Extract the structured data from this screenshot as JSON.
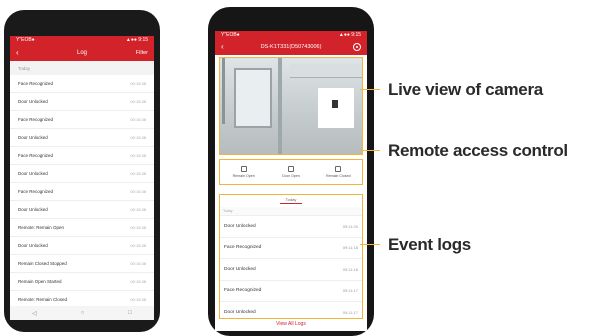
{
  "colors": {
    "brand_red": "#d2232a",
    "highlight": "#f2b53a"
  },
  "phone_log": {
    "status": {
      "left": "Y″EOB●",
      "right": "▲●● 9:15"
    },
    "title": "Log",
    "filter_label": "Filter",
    "section": "Today",
    "rows": [
      {
        "label": "Face Recognized",
        "time": "00:15:38"
      },
      {
        "label": "Door Unlocked",
        "time": "00:15:38"
      },
      {
        "label": "Face Recognized",
        "time": "00:15:38"
      },
      {
        "label": "Door Unlocked",
        "time": "00:15:38"
      },
      {
        "label": "Face Recognized",
        "time": "00:15:38"
      },
      {
        "label": "Door Unlocked",
        "time": "00:15:38"
      },
      {
        "label": "Face Recognized",
        "time": "00:15:38"
      },
      {
        "label": "Door Unlocked",
        "time": "00:15:38"
      },
      {
        "label": "Remote: Remain Open",
        "time": "00:15:38"
      },
      {
        "label": "Door Unlocked",
        "time": "00:15:38"
      },
      {
        "label": "Remain Closed Stopped",
        "time": "00:15:38"
      },
      {
        "label": "Remain Open Started",
        "time": "00:15:38"
      },
      {
        "label": "Remote: Remain Closed",
        "time": "00:15:38"
      }
    ],
    "nav": {
      "back": "◁",
      "home": "○",
      "recent": "□"
    }
  },
  "phone_device": {
    "status": {
      "left": "Y″EOB●",
      "right": "▲●● 9:15"
    },
    "title": "DS-K1T331(D50743006)",
    "remote": [
      {
        "label": "Remain Open",
        "icon": "door-open-icon"
      },
      {
        "label": "Door Open",
        "icon": "door-icon"
      },
      {
        "label": "Remain Closed",
        "icon": "door-closed-icon"
      }
    ],
    "events_tab": "Today",
    "events_day": "Today",
    "events": [
      {
        "label": "Door Unlocked",
        "time": "09:11:20"
      },
      {
        "label": "Face Recognized",
        "time": "09:11:18"
      },
      {
        "label": "Door Unlocked",
        "time": "09:11:18"
      },
      {
        "label": "Face Recognized",
        "time": "09:11:17"
      },
      {
        "label": "Door Unlocked",
        "time": "09:11:17"
      }
    ],
    "view_all": "View All Logs"
  },
  "annotations": {
    "live_view": "Live view of camera",
    "remote_access": "Remote access control",
    "event_logs": "Event logs"
  }
}
